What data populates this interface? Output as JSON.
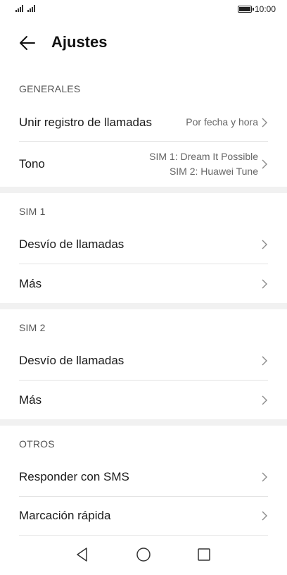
{
  "status": {
    "time": "10:00"
  },
  "header": {
    "title": "Ajustes"
  },
  "sections": {
    "generales": "GENERALES",
    "sim1": "SIM 1",
    "sim2": "SIM 2",
    "otros": "OTROS"
  },
  "rows": {
    "merge_log": {
      "label": "Unir registro de llamadas",
      "value": "Por fecha y hora"
    },
    "tono": {
      "label": "Tono",
      "value_line1": "SIM 1: Dream It Possible",
      "value_line2": "SIM 2: Huawei Tune"
    },
    "sim1_forward": {
      "label": "Desvío de llamadas"
    },
    "sim1_more": {
      "label": "Más"
    },
    "sim2_forward": {
      "label": "Desvío de llamadas"
    },
    "sim2_more": {
      "label": "Más"
    },
    "sms_reply": {
      "label": "Responder con SMS"
    },
    "speed_dial": {
      "label": "Marcación rápida"
    }
  },
  "icons": [
    "signal-icon",
    "battery-icon",
    "back-arrow-icon",
    "chevron-right-icon",
    "nav-back-icon",
    "nav-home-icon",
    "nav-recents-icon"
  ]
}
